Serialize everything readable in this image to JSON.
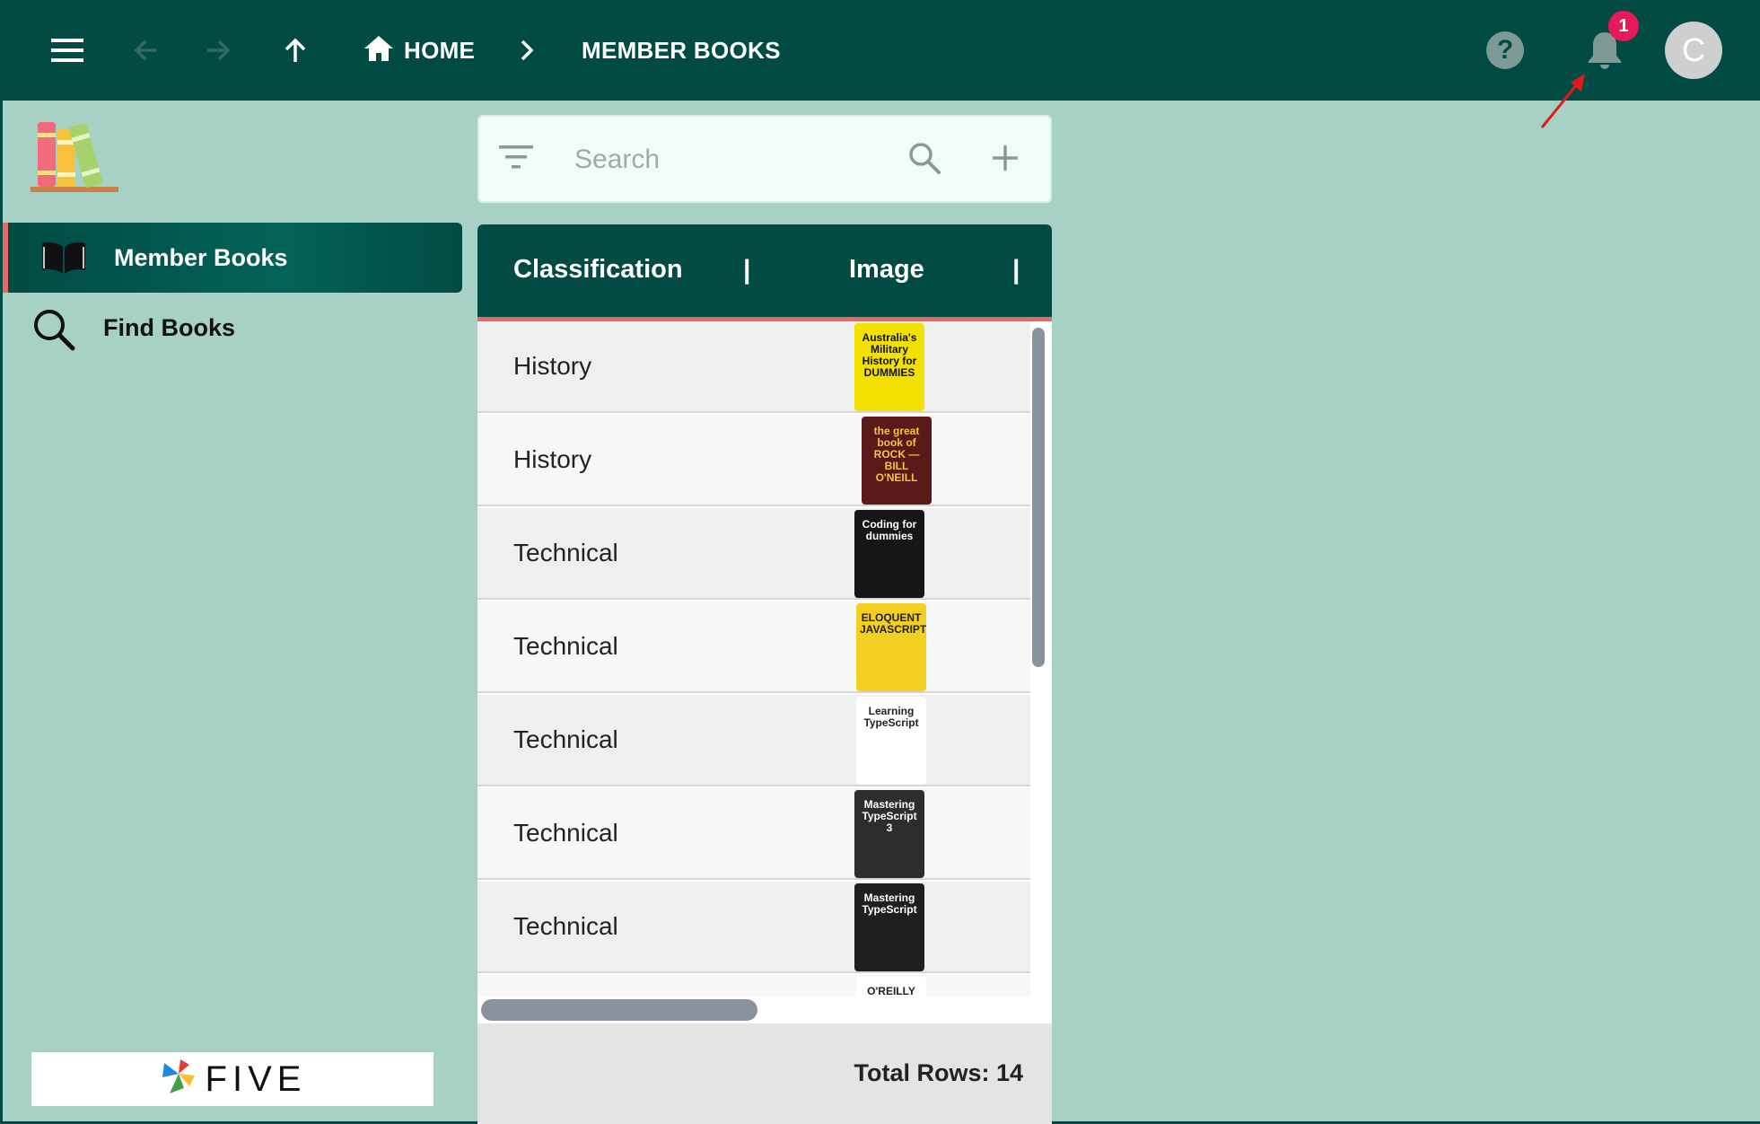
{
  "topbar": {
    "home_label": "HOME",
    "current_label": "MEMBER BOOKS",
    "help_label": "?",
    "notification_count": "1",
    "avatar_initial": "C"
  },
  "sidebar": {
    "items": [
      {
        "label": "Member Books",
        "icon": "open-book-icon",
        "active": true
      },
      {
        "label": "Find Books",
        "icon": "search-icon",
        "active": false
      }
    ],
    "brand_text": "FIVE"
  },
  "search": {
    "placeholder": "Search",
    "value": ""
  },
  "table": {
    "columns": [
      "Classification",
      "Image"
    ],
    "rows": [
      {
        "classification": "History",
        "cover_title": "Australia's Military History for DUMMIES",
        "cover_bg": "#f2e100",
        "cover_fg": "#111111"
      },
      {
        "classification": "History",
        "cover_title": "the great book of ROCK — BILL O'NEILL",
        "cover_bg": "#5a1a1a",
        "cover_fg": "#f4c542"
      },
      {
        "classification": "Technical",
        "cover_title": "Coding for dummies",
        "cover_bg": "#161616",
        "cover_fg": "#ffffff"
      },
      {
        "classification": "Technical",
        "cover_title": "ELOQUENT JAVASCRIPT",
        "cover_bg": "#f2cf20",
        "cover_fg": "#222222"
      },
      {
        "classification": "Technical",
        "cover_title": "Learning TypeScript",
        "cover_bg": "#ffffff",
        "cover_fg": "#222222"
      },
      {
        "classification": "Technical",
        "cover_title": "Mastering TypeScript 3",
        "cover_bg": "#2d2d2d",
        "cover_fg": "#ffffff"
      },
      {
        "classification": "Technical",
        "cover_title": "Mastering TypeScript",
        "cover_bg": "#1f1f1f",
        "cover_fg": "#ffffff"
      },
      {
        "classification": "",
        "cover_title": "O'REILLY Programming",
        "cover_bg": "#ffffff",
        "cover_fg": "#222222"
      }
    ],
    "total_rows_label": "Total Rows: 14"
  },
  "colors": {
    "topbar": "#024b43",
    "background": "#a8d1c5",
    "accent": "#e46a6a",
    "badge": "#e8195a"
  }
}
